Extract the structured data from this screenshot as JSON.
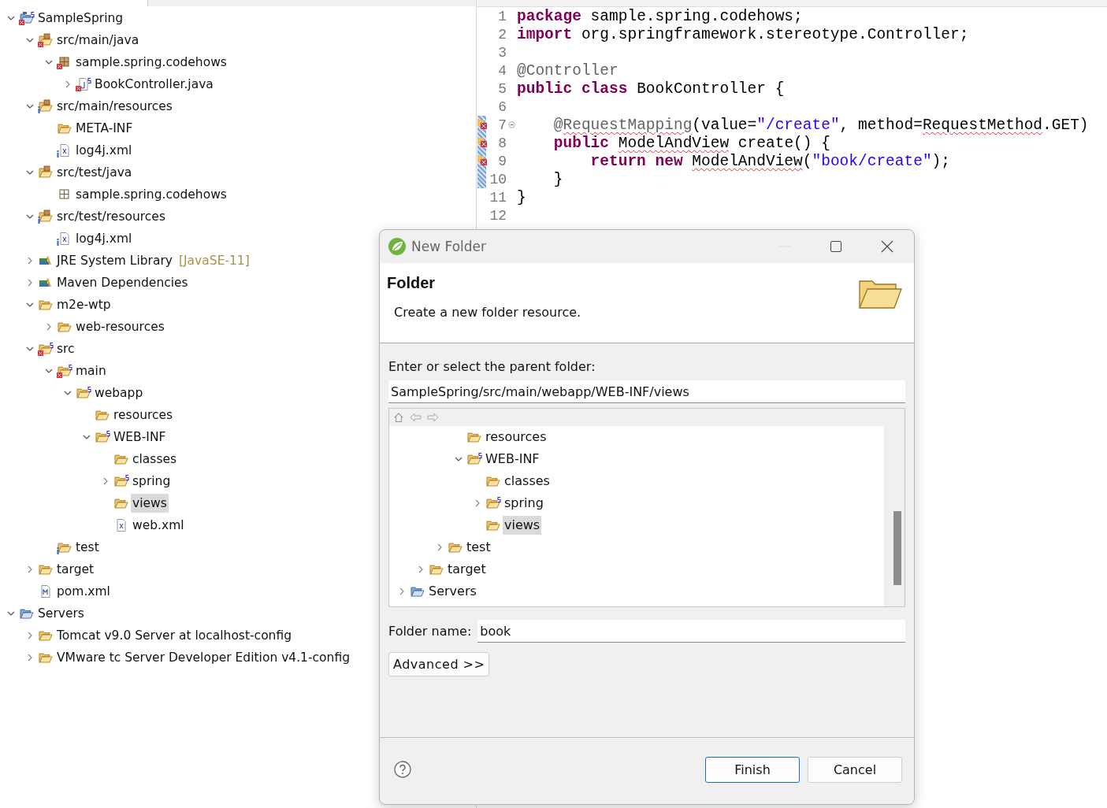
{
  "explorer": {
    "items": [
      {
        "label": "SampleSpring",
        "kind": "project",
        "error": true,
        "spring": true,
        "info": false,
        "expanded": true,
        "selected": false,
        "children": [
          {
            "label": "src/main/java",
            "kind": "source-folder",
            "error": true,
            "spring": false,
            "info": false,
            "expanded": true,
            "selected": false,
            "children": [
              {
                "label": "sample.spring.codehows",
                "kind": "package",
                "error": true,
                "spring": false,
                "info": false,
                "expanded": true,
                "selected": false,
                "children": [
                  {
                    "label": "BookController.java",
                    "kind": "java-file",
                    "error": true,
                    "spring": true,
                    "info": false,
                    "expanded": false,
                    "selected": false
                  }
                ]
              }
            ]
          },
          {
            "label": "src/main/resources",
            "kind": "source-folder",
            "error": false,
            "spring": false,
            "info": true,
            "expanded": true,
            "selected": false,
            "children": [
              {
                "label": "META-INF",
                "kind": "folder",
                "error": false,
                "spring": false,
                "info": false,
                "selected": false
              },
              {
                "label": "log4j.xml",
                "kind": "xml-file",
                "error": false,
                "spring": false,
                "info": true,
                "selected": false
              }
            ]
          },
          {
            "label": "src/test/java",
            "kind": "source-folder",
            "error": false,
            "spring": false,
            "info": false,
            "expanded": true,
            "selected": false,
            "children": [
              {
                "label": "sample.spring.codehows",
                "kind": "empty-package",
                "error": false,
                "spring": false,
                "info": false,
                "selected": false
              }
            ]
          },
          {
            "label": "src/test/resources",
            "kind": "source-folder",
            "error": false,
            "spring": false,
            "info": true,
            "expanded": true,
            "selected": false,
            "children": [
              {
                "label": "log4j.xml",
                "kind": "xml-file",
                "error": false,
                "spring": false,
                "info": true,
                "selected": false
              }
            ]
          },
          {
            "label": "JRE System Library",
            "suffix": "[JavaSE-11]",
            "kind": "library",
            "error": false,
            "spring": false,
            "info": false,
            "expanded": false,
            "selected": false
          },
          {
            "label": "Maven Dependencies",
            "kind": "library",
            "error": false,
            "spring": false,
            "info": false,
            "expanded": false,
            "selected": false
          },
          {
            "label": "m2e-wtp",
            "kind": "folder",
            "error": false,
            "spring": false,
            "info": false,
            "expanded": true,
            "selected": false,
            "children": [
              {
                "label": "web-resources",
                "kind": "folder",
                "error": false,
                "spring": false,
                "info": false,
                "expanded": false,
                "selected": false
              }
            ]
          },
          {
            "label": "src",
            "kind": "folder",
            "error": true,
            "spring": true,
            "info": false,
            "expanded": true,
            "selected": false,
            "children": [
              {
                "label": "main",
                "kind": "folder",
                "error": true,
                "spring": true,
                "info": false,
                "expanded": true,
                "selected": false,
                "children": [
                  {
                    "label": "webapp",
                    "kind": "folder",
                    "error": false,
                    "spring": true,
                    "info": false,
                    "expanded": true,
                    "selected": false,
                    "children": [
                      {
                        "label": "resources",
                        "kind": "folder",
                        "error": false,
                        "spring": false,
                        "info": false,
                        "selected": false
                      },
                      {
                        "label": "WEB-INF",
                        "kind": "folder",
                        "error": false,
                        "spring": true,
                        "info": false,
                        "expanded": true,
                        "selected": false,
                        "children": [
                          {
                            "label": "classes",
                            "kind": "folder",
                            "error": false,
                            "spring": false,
                            "info": false,
                            "selected": false
                          },
                          {
                            "label": "spring",
                            "kind": "folder",
                            "error": false,
                            "spring": true,
                            "info": false,
                            "expanded": false,
                            "selected": false
                          },
                          {
                            "label": "views",
                            "kind": "folder",
                            "error": false,
                            "spring": false,
                            "info": false,
                            "selected": true
                          },
                          {
                            "label": "web.xml",
                            "kind": "xml-file",
                            "error": false,
                            "spring": false,
                            "info": false,
                            "selected": false
                          }
                        ]
                      }
                    ]
                  }
                ]
              },
              {
                "label": "test",
                "kind": "folder",
                "error": false,
                "spring": false,
                "info": true,
                "selected": false
              }
            ]
          },
          {
            "label": "target",
            "kind": "folder",
            "error": false,
            "spring": false,
            "info": false,
            "expanded": false,
            "selected": false
          },
          {
            "label": "pom.xml",
            "kind": "pom",
            "error": false,
            "spring": false,
            "info": false,
            "selected": false
          }
        ]
      },
      {
        "label": "Servers",
        "kind": "servers",
        "error": false,
        "spring": false,
        "info": false,
        "expanded": true,
        "selected": false,
        "children": [
          {
            "label": "Tomcat v9.0 Server at localhost-config",
            "kind": "folder",
            "error": false,
            "spring": false,
            "info": false,
            "expanded": false,
            "selected": false
          },
          {
            "label": "VMware tc Server Developer Edition v4.1-config",
            "kind": "folder",
            "error": false,
            "spring": false,
            "info": false,
            "expanded": false,
            "selected": false
          }
        ]
      }
    ]
  },
  "editor": {
    "lines": [
      {
        "number": "1",
        "error": false,
        "range": false,
        "foldable": false,
        "tokens": [
          {
            "text": "package",
            "kind": "keyword"
          },
          {
            "text": " sample.spring.codehows;",
            "kind": "plain"
          }
        ]
      },
      {
        "number": "2",
        "error": false,
        "range": false,
        "foldable": false,
        "tokens": [
          {
            "text": "import",
            "kind": "keyword"
          },
          {
            "text": " org.springframework.stereotype.Controller;",
            "kind": "plain"
          }
        ]
      },
      {
        "number": "3",
        "error": false,
        "range": false,
        "foldable": false
      },
      {
        "number": "4",
        "error": false,
        "range": false,
        "foldable": false,
        "tokens": [
          {
            "text": "@Controller",
            "kind": "annotation"
          }
        ]
      },
      {
        "number": "5",
        "error": false,
        "range": false,
        "foldable": false,
        "tokens": [
          {
            "text": "public",
            "kind": "keyword"
          },
          {
            "text": " class",
            "kind": "keyword"
          },
          {
            "text": " BookController {",
            "kind": "plain"
          }
        ]
      },
      {
        "number": "6",
        "error": false,
        "range": false,
        "foldable": false
      },
      {
        "number": "7",
        "error": true,
        "range": true,
        "foldable": true,
        "tokens": [
          {
            "text": "    @",
            "kind": "annotation"
          },
          {
            "text": "RequestMapping",
            "kind": "annotation",
            "squiggle": true
          },
          {
            "text": "(value=",
            "kind": "plain"
          },
          {
            "text": "\"/create\"",
            "kind": "string"
          },
          {
            "text": ", method=",
            "kind": "plain"
          },
          {
            "text": "RequestMethod",
            "kind": "plain",
            "squiggle": true
          },
          {
            "text": ".GET)",
            "kind": "plain"
          }
        ]
      },
      {
        "number": "8",
        "error": true,
        "range": true,
        "foldable": false,
        "tokens": [
          {
            "text": "    public ",
            "kind": "keyword"
          },
          {
            "text": "ModelAndView",
            "kind": "plain",
            "squiggle": true
          },
          {
            "text": " create() {",
            "kind": "plain"
          }
        ]
      },
      {
        "number": "9",
        "error": true,
        "range": true,
        "foldable": false,
        "tokens": [
          {
            "text": "        return",
            "kind": "keyword"
          },
          {
            "text": " new ",
            "kind": "keyword"
          },
          {
            "text": "ModelAndView",
            "kind": "plain",
            "squiggle": true
          },
          {
            "text": "(",
            "kind": "plain"
          },
          {
            "text": "\"book/create\"",
            "kind": "string"
          },
          {
            "text": ");",
            "kind": "plain"
          }
        ]
      },
      {
        "number": "10",
        "error": false,
        "range": true,
        "foldable": false,
        "tokens": [
          {
            "text": "    }",
            "kind": "plain"
          }
        ]
      },
      {
        "number": "11",
        "error": false,
        "range": false,
        "foldable": false,
        "tokens": [
          {
            "text": "}",
            "kind": "plain"
          }
        ]
      },
      {
        "number": "12",
        "error": false,
        "range": false,
        "foldable": false
      }
    ]
  },
  "dialog": {
    "title": "New Folder",
    "header_title": "Folder",
    "header_message": "Create a new folder resource.",
    "parent_label": "Enter or select the parent folder:",
    "parent_value": "SampleSpring/src/main/webapp/WEB-INF/views",
    "tree": {
      "items": [
        {
          "children": [
            {
              "children": [
                {
                  "children": [
                    {
                      "label": "resources",
                      "kind": "folder",
                      "spring": false,
                      "selected": false
                    },
                    {
                      "label": "WEB-INF",
                      "kind": "folder",
                      "spring": true,
                      "expanded": true,
                      "selected": false,
                      "children": [
                        {
                          "label": "classes",
                          "kind": "folder",
                          "spring": false,
                          "selected": false
                        },
                        {
                          "label": "spring",
                          "kind": "folder",
                          "spring": true,
                          "expanded": false,
                          "selected": false
                        },
                        {
                          "label": "views",
                          "kind": "folder",
                          "spring": false,
                          "selected": true
                        }
                      ]
                    }
                  ]
                },
                {
                  "label": "test",
                  "kind": "folder",
                  "spring": false,
                  "expanded": false,
                  "selected": false
                }
              ]
            },
            {
              "label": "target",
              "kind": "folder",
              "spring": false,
              "expanded": false,
              "selected": false
            }
          ]
        },
        {
          "label": "Servers",
          "kind": "servers",
          "spring": false,
          "expanded": false,
          "selected": false
        }
      ]
    },
    "folder_name_label": "Folder name:",
    "folder_name_value": "book",
    "advanced_button": "Advanced >>",
    "buttons": [
      {
        "label": "Finish",
        "default": true
      },
      {
        "label": "Cancel",
        "default": false
      }
    ]
  }
}
